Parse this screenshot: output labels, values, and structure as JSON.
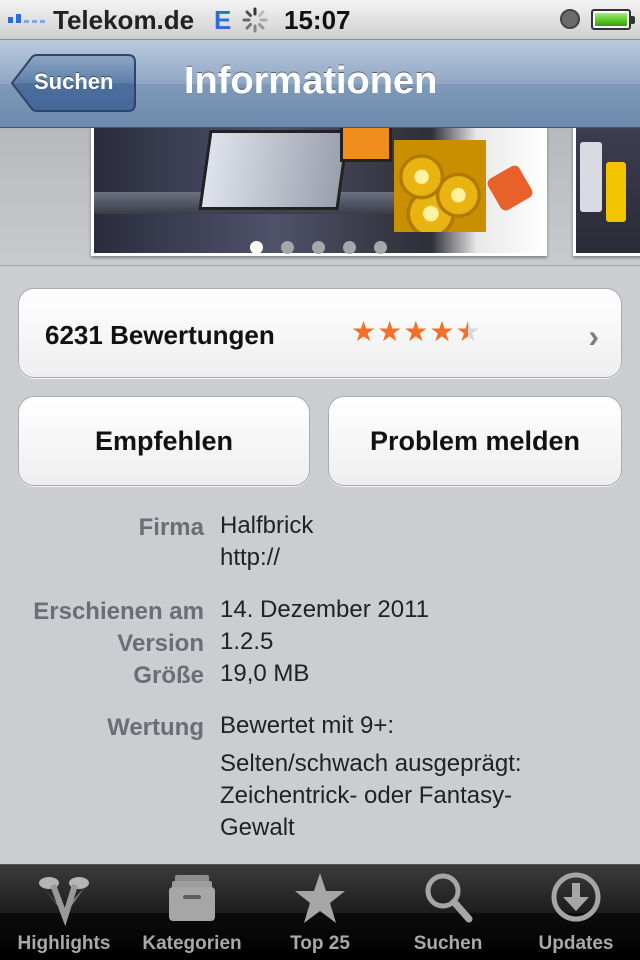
{
  "status_bar": {
    "carrier": "Telekom.de",
    "network": "E",
    "time": "15:07"
  },
  "nav": {
    "back_label": "Suchen",
    "title": "Informationen"
  },
  "screenshots": {
    "count": 5,
    "active_index": 0
  },
  "ratings": {
    "label": "6231 Bewertungen",
    "stars": 4.5
  },
  "buttons": {
    "recommend": "Empfehlen",
    "report": "Problem melden"
  },
  "details": {
    "company_key": "Firma",
    "company_value": "Halfbrick",
    "company_url": "http://",
    "released_key": "Erschienen am",
    "released_value": "14. Dezember 2011",
    "version_key": "Version",
    "version_value": "1.2.5",
    "size_key": "Größe",
    "size_value": "19,0 MB",
    "rating_key": "Wertung",
    "rating_line1": "Bewertet mit 9+:",
    "rating_line2": "Selten/schwach ausgeprägt:",
    "rating_line3": "Zeichentrick- oder Fantasy-",
    "rating_line4": "Gewalt"
  },
  "tabbar": {
    "tabs": [
      {
        "label": "Highlights",
        "icon": "highlights-icon"
      },
      {
        "label": "Kategorien",
        "icon": "categories-icon"
      },
      {
        "label": "Top 25",
        "icon": "star-icon"
      },
      {
        "label": "Suchen",
        "icon": "search-icon"
      },
      {
        "label": "Updates",
        "icon": "updates-icon"
      }
    ]
  },
  "colors": {
    "nav_blue": "#6d89ab",
    "star_orange": "#f2702a",
    "background": "#cbcdd1",
    "label_gray": "#6b6e75"
  }
}
